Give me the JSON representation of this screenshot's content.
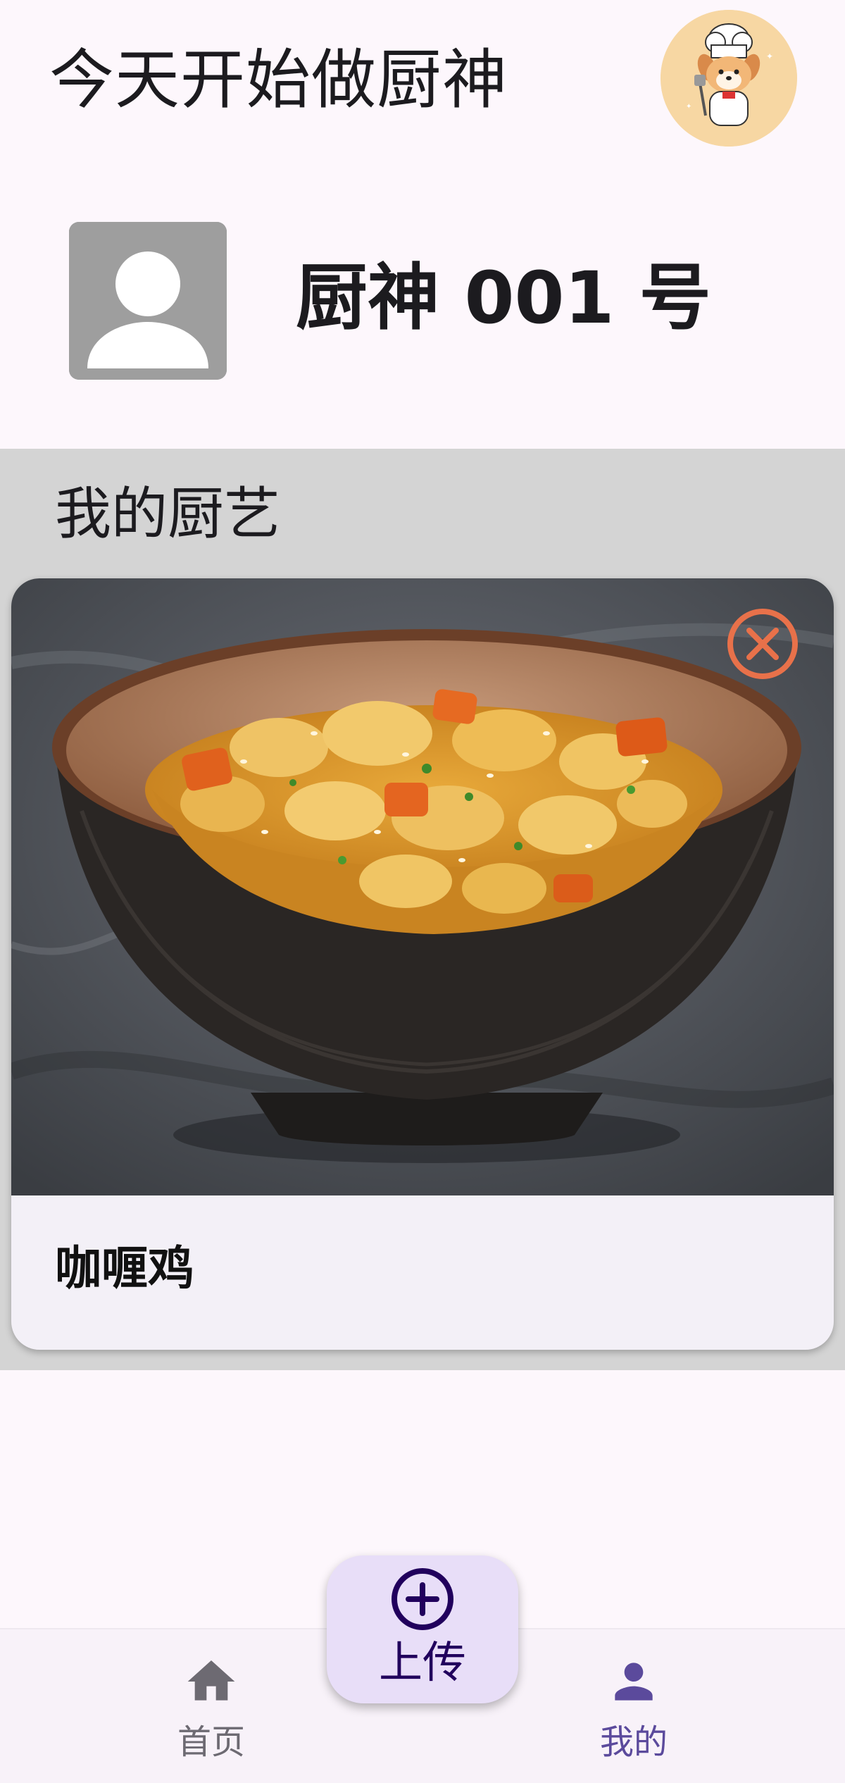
{
  "header": {
    "title": "今天开始做厨神",
    "logo_icon": "chef-dog-icon"
  },
  "profile": {
    "avatar_icon": "person-icon",
    "username": "厨神 001 号"
  },
  "dishes_section": {
    "title": "我的厨艺",
    "items": [
      {
        "name": "咖喱鸡",
        "photo_icon": "curry-chicken-photo",
        "delete_icon": "close-circle-icon"
      }
    ]
  },
  "bottom_nav": {
    "items": [
      {
        "label": "首页",
        "icon": "home-icon",
        "active": false
      },
      {
        "label": "我的",
        "icon": "person-icon",
        "active": true
      }
    ]
  },
  "upload_fab": {
    "label": "上传",
    "icon": "add-circle-icon"
  },
  "colors": {
    "background": "#fdf7fc",
    "section_background": "#d4d4d4",
    "card_background": "#f3f0f7",
    "delete_accent": "#e8714a",
    "fab_background": "#e8def8",
    "active_nav": "#5b4a9c",
    "inactive_nav": "#6d6a72"
  }
}
